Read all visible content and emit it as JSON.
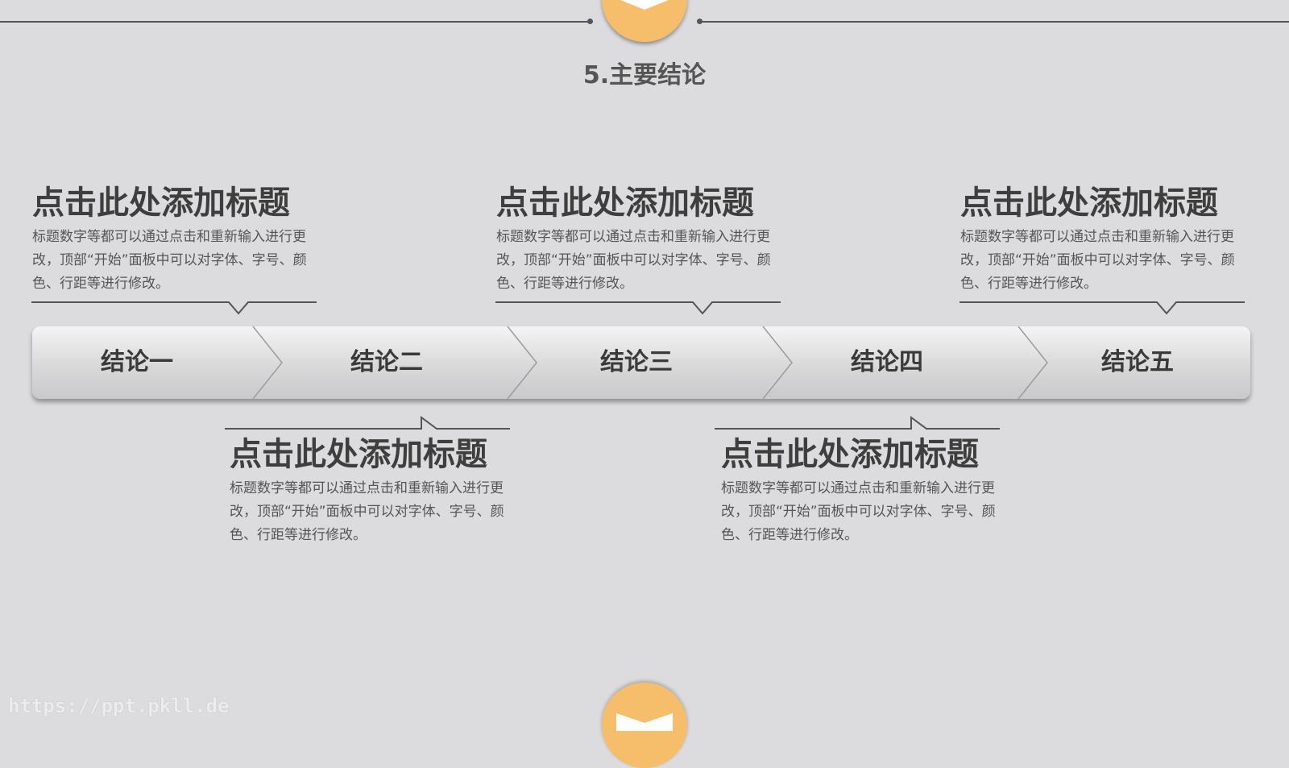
{
  "section_title": "5.主要结论",
  "steps": [
    {
      "label": "结论一"
    },
    {
      "label": "结论二"
    },
    {
      "label": "结论三"
    },
    {
      "label": "结论四"
    },
    {
      "label": "结论五"
    }
  ],
  "blocks": [
    {
      "heading": "点击此处添加标题",
      "body": "标题数字等都可以通过点击和重新输入进行更改，顶部“开始”面板中可以对字体、字号、颜色、行距等进行修改。"
    },
    {
      "heading": "点击此处添加标题",
      "body": "标题数字等都可以通过点击和重新输入进行更改，顶部“开始”面板中可以对字体、字号、颜色、行距等进行修改。"
    },
    {
      "heading": "点击此处添加标题",
      "body": "标题数字等都可以通过点击和重新输入进行更改，顶部“开始”面板中可以对字体、字号、颜色、行距等进行修改。"
    },
    {
      "heading": "点击此处添加标题",
      "body": "标题数字等都可以通过点击和重新输入进行更改，顶部“开始”面板中可以对字体、字号、颜色、行距等进行修改。"
    },
    {
      "heading": "点击此处添加标题",
      "body": "标题数字等都可以通过点击和重新输入进行更改，顶部“开始”面板中可以对字体、字号、颜色、行距等进行修改。"
    }
  ],
  "watermark": "https://ppt.pkll.de",
  "colors": {
    "accent": "#f6be6b",
    "background": "#dcdcde",
    "text": "#3e3e3e"
  },
  "icons": {
    "top": "chevron-down-icon",
    "bottom": "chevron-down-icon"
  }
}
